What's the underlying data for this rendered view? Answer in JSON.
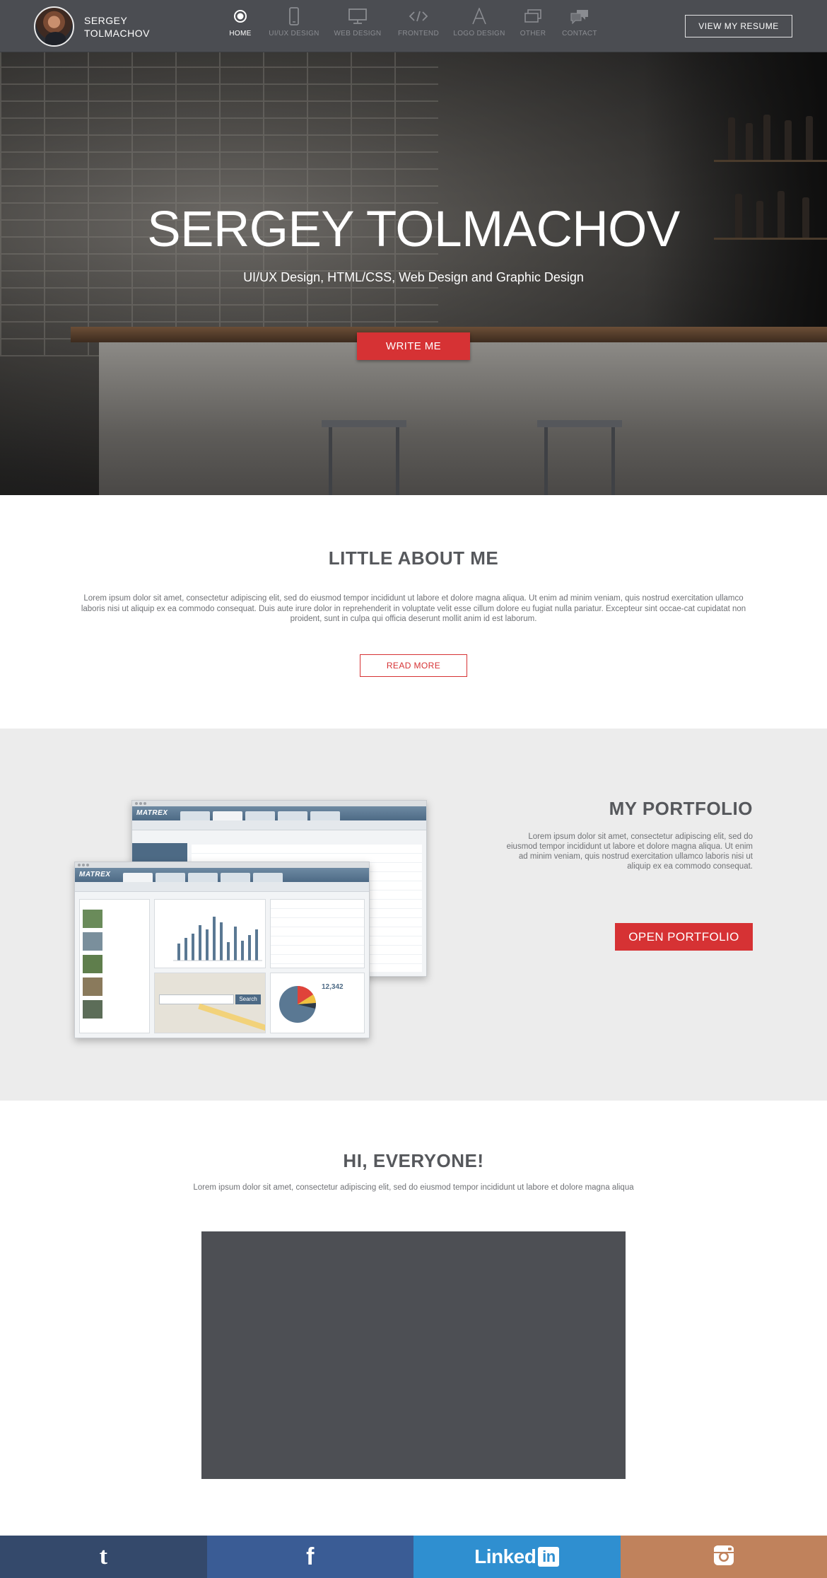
{
  "header": {
    "brand_line1": "SERGEY",
    "brand_line2": "TOLMACHOV",
    "resume_label": "VIEW MY RESUME",
    "nav": [
      {
        "label": "HOME",
        "icon": "home-dot-icon"
      },
      {
        "label": "UI/UX DESIGN",
        "icon": "mobile-icon"
      },
      {
        "label": "WEB DESIGN",
        "icon": "monitor-icon"
      },
      {
        "label": "FRONTEND",
        "icon": "code-icon"
      },
      {
        "label": "LOGO DESIGN",
        "icon": "letter-a-icon"
      },
      {
        "label": "OTHER",
        "icon": "windows-icon"
      },
      {
        "label": "CONTACT",
        "icon": "chat-icon"
      }
    ]
  },
  "hero": {
    "title": "SERGEY TOLMACHOV",
    "subtitle": "UI/UX Design, HTML/CSS, Web Design and Graphic Design",
    "button": "WRITE ME"
  },
  "about": {
    "title": "LITTLE ABOUT ME",
    "text": "Lorem ipsum dolor sit amet, consectetur adipiscing elit, sed do eiusmod tempor incididunt ut labore et dolore magna aliqua. Ut enim ad minim veniam, quis nostrud exercitation ullamco laboris nisi ut aliquip ex ea commodo consequat. Duis aute irure dolor in reprehenderit in voluptate velit esse cillum dolore eu fugiat nulla pariatur. Excepteur sint occae-cat cupidatat non proident, sunt in culpa qui officia deserunt mollit anim id est laborum.",
    "button": "READ MORE"
  },
  "portfolio": {
    "title": "MY PORTFOLIO",
    "text": "Lorem ipsum dolor sit amet, consectetur adipiscing elit, sed do eiusmod tempor incididunt ut labore et dolore magna aliqua. Ut enim ad minim veniam, quis nostrud exercitation ullamco laboris nisi ut aliquip ex ea commodo consequat.",
    "button": "OPEN PORTFOLIO",
    "mock_logo": "MATREX",
    "mock_counter": "12,342",
    "mock_search": "Search"
  },
  "hi": {
    "title": "HI, EVERYONE!",
    "text": "Lorem ipsum dolor sit amet, consectetur adipiscing elit, sed do eiusmod tempor incididunt ut labore et dolore magna aliqua"
  },
  "social": {
    "tumblr": "t",
    "facebook": "f",
    "linkedin_text": "Linked",
    "linkedin_box": "in",
    "colors": {
      "tumblr": "#34496b",
      "facebook": "#3a5c95",
      "linkedin": "#2f8fd0",
      "instagram": "#c0825c"
    }
  },
  "colors": {
    "accent": "#d63234",
    "header": "#4b4d52",
    "portfolio_bg": "#ececec"
  }
}
